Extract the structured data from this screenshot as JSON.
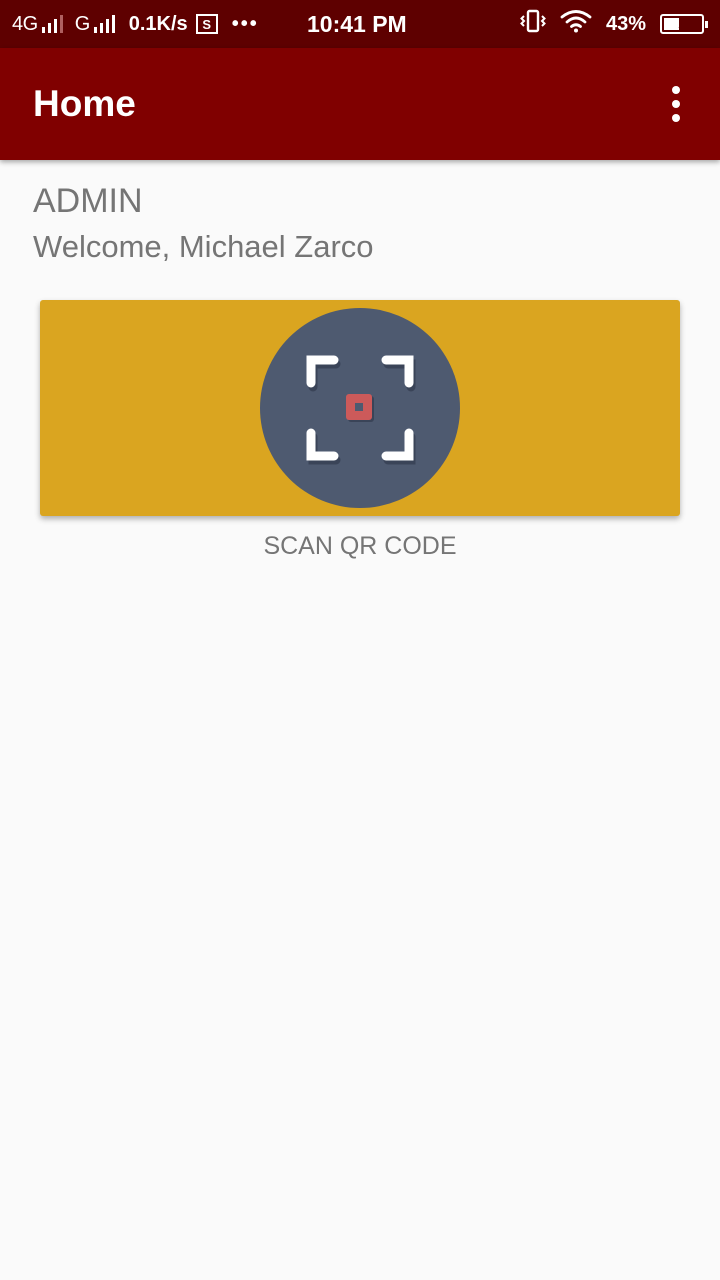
{
  "status_bar": {
    "network_1": "4G",
    "network_2": "G",
    "speed": "0.1K/s",
    "s_badge": "S",
    "more": "•••",
    "time": "10:41 PM",
    "battery_percent": "43%",
    "battery_level": 0.43
  },
  "app_bar": {
    "title": "Home",
    "overflow_icon": "more-vert-icon"
  },
  "main": {
    "role": "ADMIN",
    "welcome": "Welcome, Michael Zarco",
    "scan_label": "SCAN QR CODE"
  },
  "colors": {
    "status_bar": "#5e0000",
    "app_bar": "#800000",
    "card": "#daa520",
    "scan_circle": "#4e5a70",
    "scan_center": "#cc5a5a"
  }
}
